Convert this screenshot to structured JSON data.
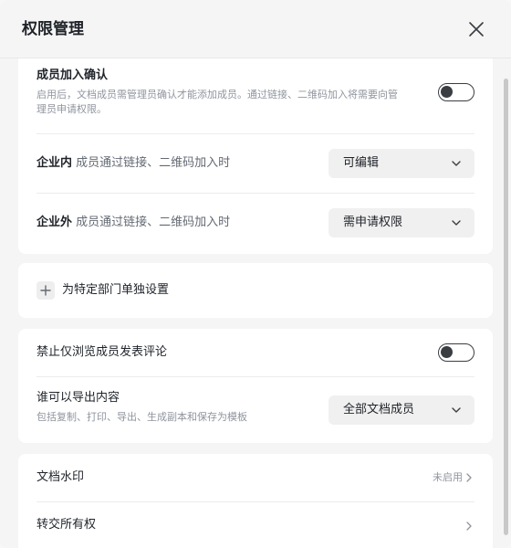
{
  "dialog": {
    "title": "权限管理"
  },
  "member_confirm": {
    "title": "成员加入确认",
    "description": "启用后，文档成员需管理员确认才能添加成员。通过链接、二维码加入将需要向管理员申请权限。",
    "toggle_on": false
  },
  "inside_org": {
    "label": "企业内",
    "desc": "成员通过链接、二维码加入时",
    "value": "可编辑"
  },
  "outside_org": {
    "label": "企业外",
    "desc": "成员通过链接、二维码加入时",
    "value": "需申请权限"
  },
  "department": {
    "label": "为特定部门单独设置"
  },
  "comment": {
    "label": "禁止仅浏览成员发表评论",
    "toggle_on": false
  },
  "export": {
    "label": "谁可以导出内容",
    "desc": "包括复制、打印、导出、生成副本和保存为模板",
    "value": "全部文档成员"
  },
  "watermark": {
    "label": "文档水印",
    "status": "未启用"
  },
  "transfer": {
    "label": "转交所有权"
  },
  "icons": {
    "close": "close-icon",
    "chevron": "chevron-down-icon",
    "plus": "plus-icon",
    "arrow": "chevron-right-icon"
  }
}
